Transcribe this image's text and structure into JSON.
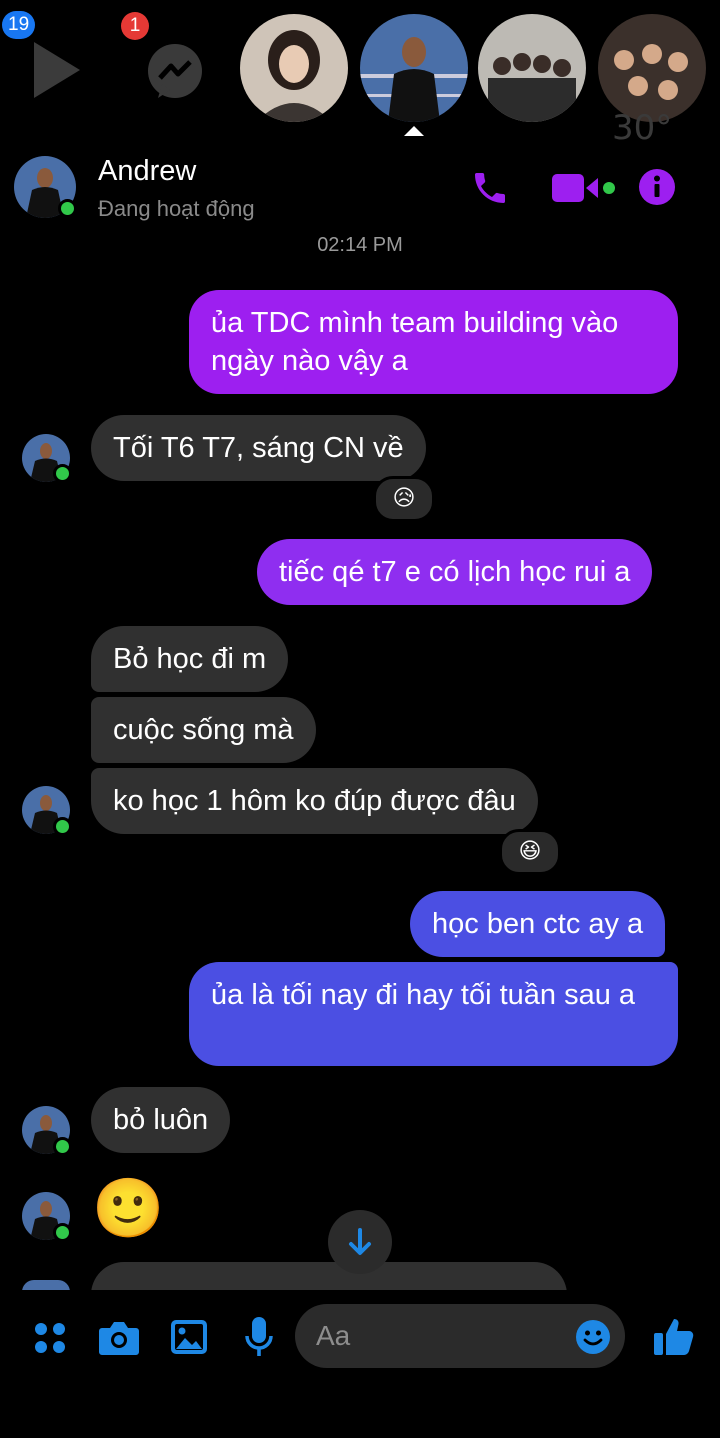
{
  "app_title": "Messenger",
  "chat_heads": {
    "video_badge": "19",
    "messenger_badge": "1",
    "weather_temp": "30°"
  },
  "header": {
    "contact_name": "Andrew",
    "status": "Đang hoạt động"
  },
  "timestamp": "02:14 PM",
  "messages": [
    {
      "from": "me",
      "text": "ủa TDC mình team building vào ngày nào vậy a"
    },
    {
      "from": "Andrew",
      "text": "Tối T6 T7, sáng CN về",
      "reaction": "😥"
    },
    {
      "from": "me",
      "text": "tiếc qé t7 e có lịch học rui a"
    },
    {
      "from": "Andrew",
      "text": "Bỏ học đi m"
    },
    {
      "from": "Andrew",
      "text": "cuộc sống mà"
    },
    {
      "from": "Andrew",
      "text": "ko học 1 hôm ko đúp được đâu",
      "reaction": "😆"
    },
    {
      "from": "me",
      "text": "học ben ctc ay a"
    },
    {
      "from": "me",
      "text": "ủa là tối nay đi hay tối tuần sau a"
    },
    {
      "from": "Andrew",
      "text": "bỏ luôn"
    },
    {
      "from": "Andrew",
      "text": "🙂"
    }
  ],
  "composer": {
    "placeholder": "Aa"
  },
  "icons": {
    "call": "phone-icon",
    "video": "video-call-icon",
    "info": "info-icon",
    "menu": "apps-icon",
    "camera": "camera-icon",
    "gallery": "image-icon",
    "mic": "microphone-icon",
    "emoji": "emoji-icon",
    "like": "thumbs-up-icon",
    "scroll": "arrow-down-icon"
  },
  "colors": {
    "accent_purple": "#9d1ff0",
    "outgoing_blue": "#4b4fe3",
    "icon_blue": "#1e88e5",
    "incoming_bubble": "#303030"
  }
}
